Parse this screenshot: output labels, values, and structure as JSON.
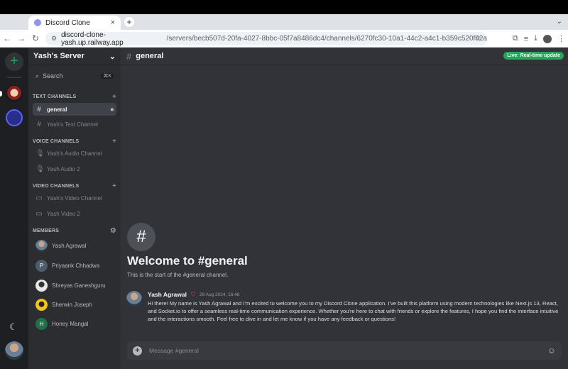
{
  "browser": {
    "tab_title": "Discord Clone",
    "tab_close": "×",
    "new_tab": "+",
    "tab_menu": "⌄",
    "url_host": "discord-clone-yash.up.railway.app",
    "url_path": "/servers/becb507d-20fa-4027-8bbc-05f7a8486dc4/channels/6270fc30-10a1-44c2-a4c1-b359c520f82a",
    "icons": [
      "back-icon",
      "forward-icon",
      "reload-icon",
      "site-info-icon",
      "star-icon",
      "extensions-icon",
      "media-icon",
      "download-icon",
      "profile-icon",
      "menu-icon"
    ]
  },
  "rail": {
    "add_label": "+",
    "theme_icon": "☾"
  },
  "server": {
    "name": "Yash's Server",
    "chevron": "⌄"
  },
  "search": {
    "label": "Search",
    "shortcut": "⌘K"
  },
  "sections": {
    "text": "TEXT CHANNELS",
    "voice": "VOICE CHANNELS",
    "video": "VIDEO CHANNELS",
    "members": "MEMBERS"
  },
  "channels": {
    "text": [
      "general",
      "Yash's Text Channel"
    ],
    "voice": [
      "Yash's Audio Channel",
      "Yash Audio 2"
    ],
    "video": [
      "Yash's Video Channel",
      "Yash Video 2"
    ]
  },
  "members": [
    {
      "name": "Yash Agrawal",
      "initial": "",
      "color": "#6b7f92"
    },
    {
      "name": "Priyaank Chhadwa",
      "initial": "P",
      "color": "#4e5d6c"
    },
    {
      "name": "Shreyas Ganeshguru",
      "initial": "",
      "color": "#e8e8e8"
    },
    {
      "name": "Sherwin Joseph",
      "initial": "",
      "color": "#f0c419"
    },
    {
      "name": "Honey Mangal",
      "initial": "H",
      "color": "#1f6f4a"
    }
  ],
  "chat": {
    "channel": "general",
    "live_badge": "Live: Real-time update",
    "welcome_title": "Welcome to #general",
    "welcome_sub": "This is the start of the #general channel.",
    "composer_placeholder": "Message #general"
  },
  "message": {
    "author": "Yash Agrawal",
    "time": "29 Aug 2024, 16:48",
    "text": "Hi there! My name is Yash Agrawal and I'm excited to welcome you to my Discord Clone application. I've built this platform using modern technologies like Next.js 13, React, and Socket.io to offer a seamless real-time communication experience. Whether you're here to chat with friends or explore the features, I hope you find the interface intuitive and the interactions smooth. Feel free to dive in and let me know if you have any feedback or questions!"
  },
  "colors": {
    "accent_green": "#23a55a",
    "online_green": "#23a559",
    "admin_red": "#f23f43",
    "background_chat": "#313338",
    "background_panel": "#2b2d31",
    "background_rail": "#1e1f22"
  }
}
